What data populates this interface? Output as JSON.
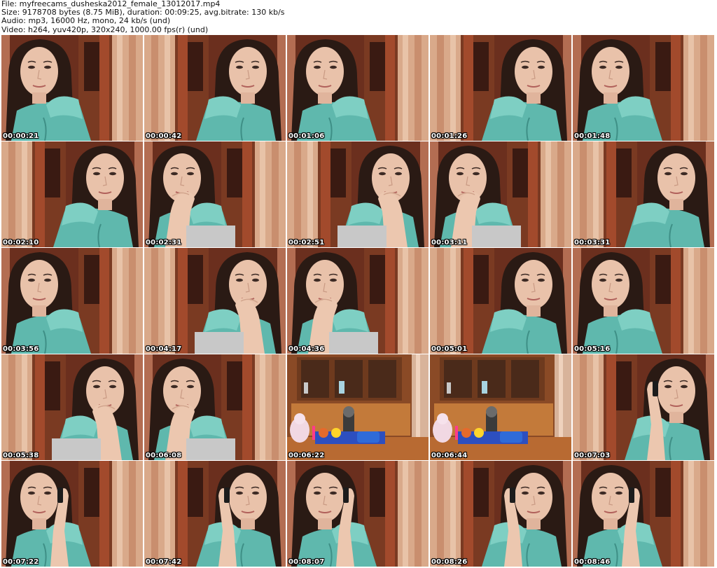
{
  "header": {
    "file_line": "File: myfreecams_dusheska2012_female_13012017.mp4",
    "size_line": "Size: 9178708 bytes (8.75 MiB), duration: 00:09:25, avg.bitrate: 130 kb/s",
    "audio_line": "Audio: mp3, 16000 Hz, mono, 24 kb/s (und)",
    "video_line": "Video: h264, yuv420p, 320x240, 1000.00 fps(r) (und)"
  },
  "thumbnails": [
    {
      "time": "00:00:21",
      "scene": "person"
    },
    {
      "time": "00:00:42",
      "scene": "person"
    },
    {
      "time": "00:01:06",
      "scene": "person"
    },
    {
      "time": "00:01:26",
      "scene": "person"
    },
    {
      "time": "00:01:48",
      "scene": "person"
    },
    {
      "time": "00:02:10",
      "scene": "person"
    },
    {
      "time": "00:02:31",
      "scene": "person-hand"
    },
    {
      "time": "00:02:51",
      "scene": "person-hand"
    },
    {
      "time": "00:03:11",
      "scene": "person-hand"
    },
    {
      "time": "00:03:31",
      "scene": "person"
    },
    {
      "time": "00:03:56",
      "scene": "person"
    },
    {
      "time": "00:04:17",
      "scene": "person-hand"
    },
    {
      "time": "00:04:36",
      "scene": "person-hand"
    },
    {
      "time": "00:05:01",
      "scene": "person"
    },
    {
      "time": "00:05:16",
      "scene": "person"
    },
    {
      "time": "00:05:38",
      "scene": "person-hand"
    },
    {
      "time": "00:06:08",
      "scene": "person-hand"
    },
    {
      "time": "00:06:22",
      "scene": "room"
    },
    {
      "time": "00:06:44",
      "scene": "room"
    },
    {
      "time": "00:07:03",
      "scene": "person-phone"
    },
    {
      "time": "00:07:22",
      "scene": "person-phone"
    },
    {
      "time": "00:07:42",
      "scene": "person-phone"
    },
    {
      "time": "00:08:07",
      "scene": "person-phone"
    },
    {
      "time": "00:08:26",
      "scene": "person-phone"
    },
    {
      "time": "00:08:46",
      "scene": "person-phone"
    }
  ]
}
